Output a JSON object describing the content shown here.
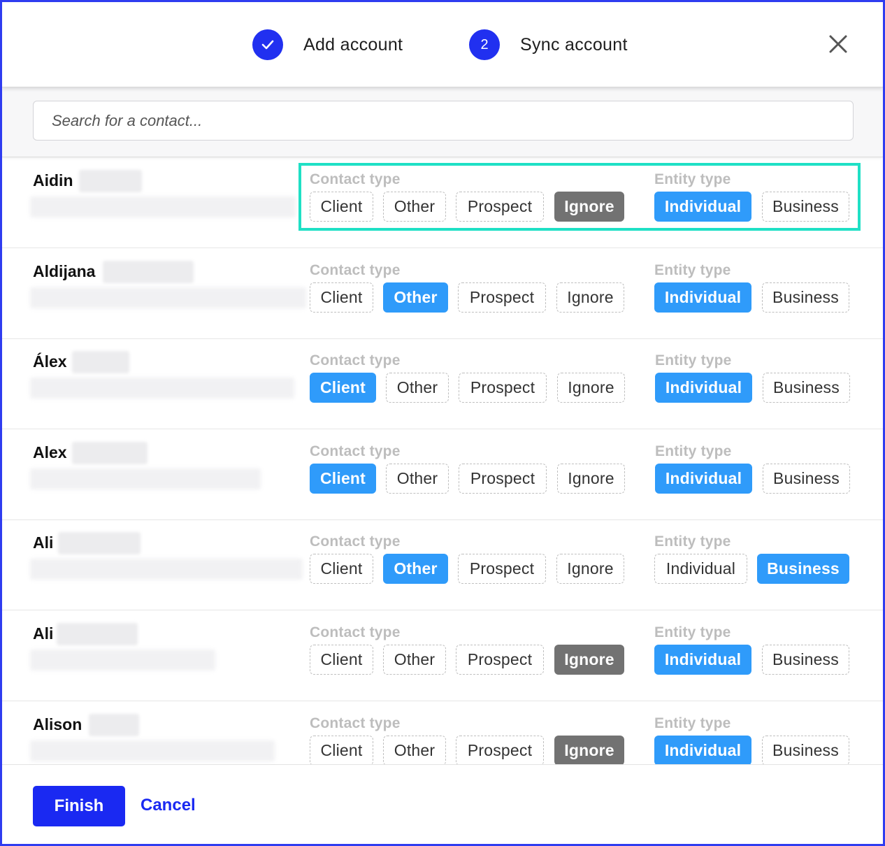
{
  "stepper": {
    "steps": [
      {
        "label": "Add account",
        "state": "done",
        "icon": "check-icon"
      },
      {
        "label": "Sync account",
        "state": "current",
        "number": "2"
      }
    ],
    "close_icon": "close-icon"
  },
  "search": {
    "placeholder": "Search for a contact...",
    "value": ""
  },
  "labels": {
    "contact_type": "Contact type",
    "entity_type": "Entity type"
  },
  "contact_type_options": [
    "Client",
    "Other",
    "Prospect",
    "Ignore"
  ],
  "entity_type_options": [
    "Individual",
    "Business"
  ],
  "contacts": [
    {
      "first_name": "Aidin",
      "contact_type": "Ignore",
      "entity_type": "Individual",
      "highlighted": true
    },
    {
      "first_name": "Aldijana",
      "contact_type": "Other",
      "entity_type": "Individual",
      "highlighted": false
    },
    {
      "first_name": "Álex",
      "contact_type": "Client",
      "entity_type": "Individual",
      "highlighted": false
    },
    {
      "first_name": "Alex",
      "contact_type": "Client",
      "entity_type": "Individual",
      "highlighted": false
    },
    {
      "first_name": "Ali",
      "contact_type": "Other",
      "entity_type": "Business",
      "highlighted": false
    },
    {
      "first_name": "Ali",
      "contact_type": "Ignore",
      "entity_type": "Individual",
      "highlighted": false
    },
    {
      "first_name": "Alison",
      "contact_type": "Ignore",
      "entity_type": "Individual",
      "highlighted": false
    }
  ],
  "footer": {
    "finish_label": "Finish",
    "cancel_label": "Cancel"
  },
  "colors": {
    "primary": "#1a29f2",
    "selected_chip": "#2f9bfa",
    "ignore_chip": "#727272",
    "highlight_border": "#1fe0c5"
  }
}
